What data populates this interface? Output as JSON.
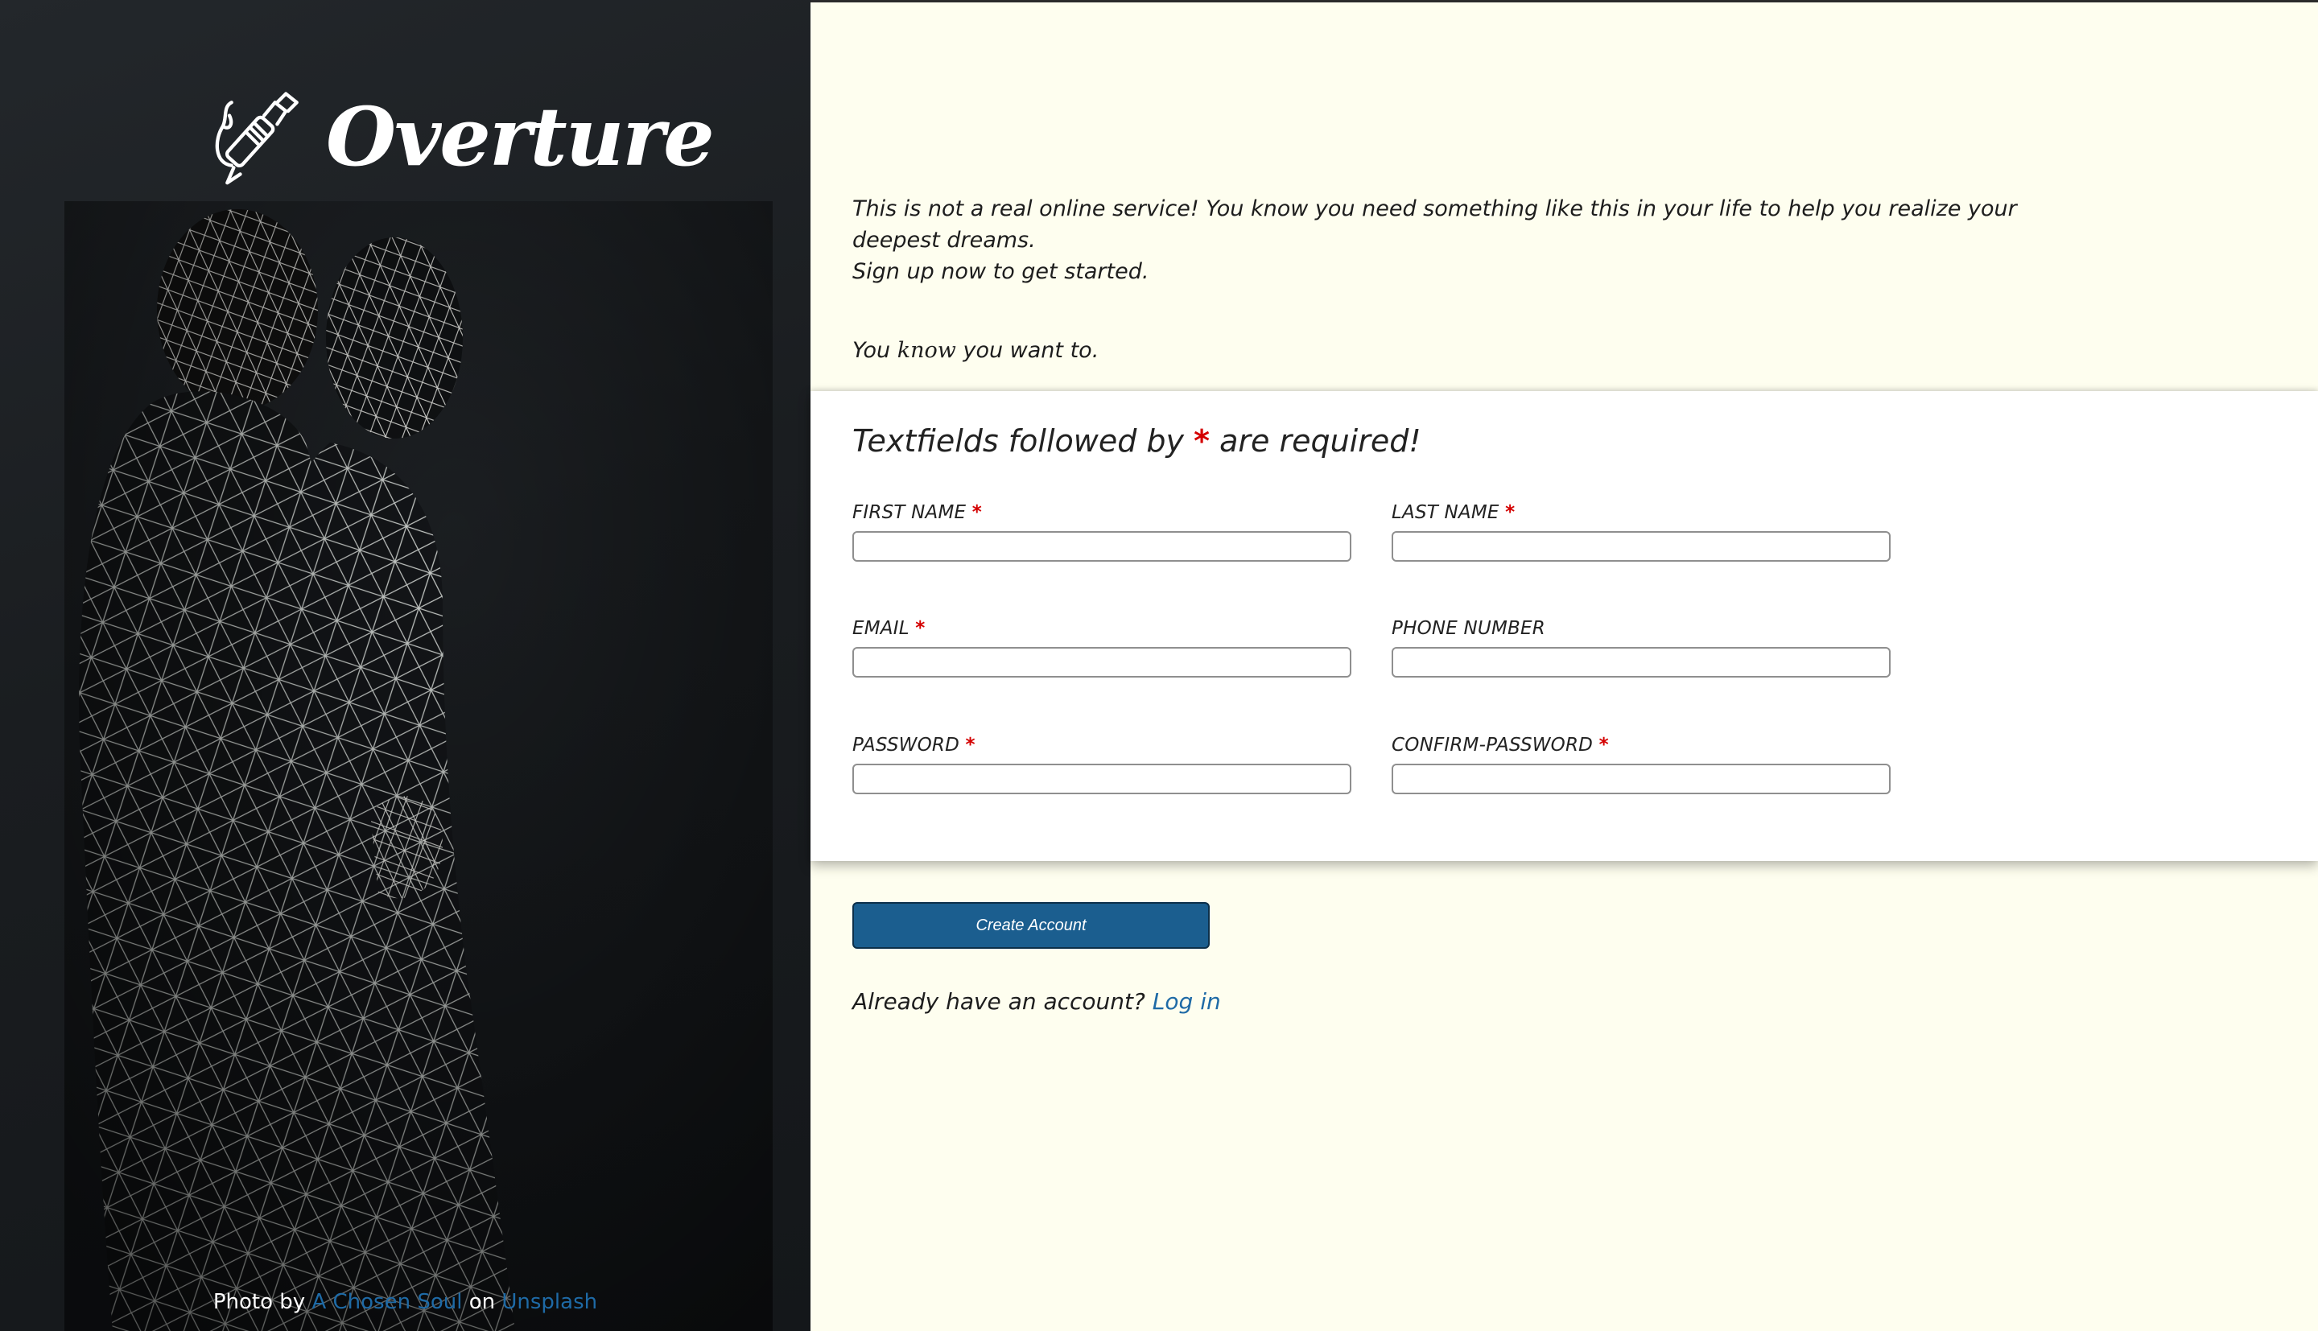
{
  "brand": {
    "name": "Overture",
    "icon": "pen-icon"
  },
  "photo_credit": {
    "prefix": "Photo by",
    "author": "A Chosen Soul",
    "middle": "on",
    "source": "Unsplash"
  },
  "intro": {
    "line1": "This is not a real online service! You know you need something like this in your life to help you realize your deepest dreams.",
    "line2": "Sign up now to get started.",
    "line3_pre": "You",
    "line3_em": "know",
    "line3_post": "you want to."
  },
  "form": {
    "heading_pre": "Textfields followed by",
    "required_mark": "*",
    "heading_post": "are required!",
    "fields": {
      "first_name": {
        "label": "FIRST NAME",
        "required": true,
        "value": ""
      },
      "last_name": {
        "label": "LAST NAME",
        "required": true,
        "value": ""
      },
      "email": {
        "label": "EMAIL",
        "required": true,
        "value": ""
      },
      "phone": {
        "label": "PHONE NUMBER",
        "required": false,
        "value": ""
      },
      "password": {
        "label": "PASSWORD",
        "required": true,
        "value": ""
      },
      "confirm_password": {
        "label": "CONFIRM-PASSWORD",
        "required": true,
        "value": ""
      }
    },
    "submit_label": "Create Account"
  },
  "login": {
    "prompt": "Already have an account?",
    "link_label": "Log in"
  },
  "colors": {
    "left_bg": "#1c1f22",
    "right_bg": "#fefeef",
    "button": "#1b5e8f",
    "link": "#1e6aa6",
    "required": "#d40000"
  }
}
